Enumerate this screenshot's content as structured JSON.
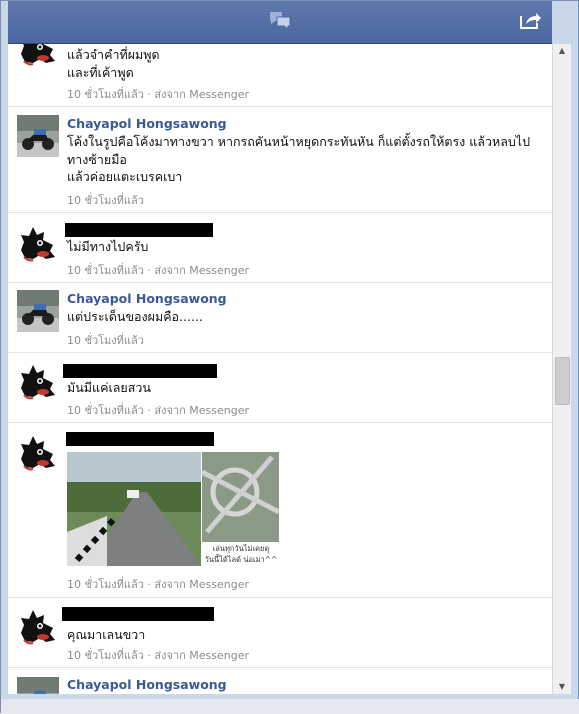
{
  "header": {
    "chat_icon": "chat-bubbles-icon",
    "share_icon": "share-icon"
  },
  "messages": [
    {
      "kind": "dog",
      "lines": [
        "แล้วจำคำที่ผมพูด",
        "และที่เค้าพูด"
      ],
      "time": "10 ชั่วโมงที่แล้ว · ส่งจาก Messenger"
    },
    {
      "kind": "chayapol",
      "name": "Chayapol Hongsawong",
      "lines": [
        "โค้งในรูปคือโค้งมาทางขวา หากรถคันหน้าหยุดกระทันหัน ก็แต่ตั้งรถให้ตรง แล้วหลบไปทางซ้ายมือ",
        "แล้วค่อยแตะเบรคเบา"
      ],
      "time": "10 ชั่วโมงที่แล้ว"
    },
    {
      "kind": "dog",
      "lines": [
        "ไม่มีทางไปครับ"
      ],
      "time": "10 ชั่วโมงที่แล้ว · ส่งจาก Messenger"
    },
    {
      "kind": "chayapol",
      "name": "Chayapol Hongsawong",
      "lines": [
        "แต่ประเด็นของผมคือ......"
      ],
      "time": "10 ชั่วโมงที่แล้ว"
    },
    {
      "kind": "dog",
      "lines": [
        "มันมีแค่เลยสวน"
      ],
      "time": "10 ชั่วโมงที่แล้ว · ส่งจาก Messenger"
    },
    {
      "kind": "dog-photo",
      "photo_caption": [
        "เล่นทุกวันไม่เคยดุ",
        "วันนี้ได้ไลด์ น่อเมา^^"
      ],
      "time": "10 ชั่วโมงที่แล้ว · ส่งจาก Messenger"
    },
    {
      "kind": "dog",
      "lines": [
        "คุณมาเลนขวา"
      ],
      "time": "10 ชั่วโมงที่แล้ว · ส่งจาก Messenger"
    },
    {
      "kind": "chayapol",
      "name": "Chayapol Hongsawong",
      "lines": [],
      "time": ""
    }
  ]
}
